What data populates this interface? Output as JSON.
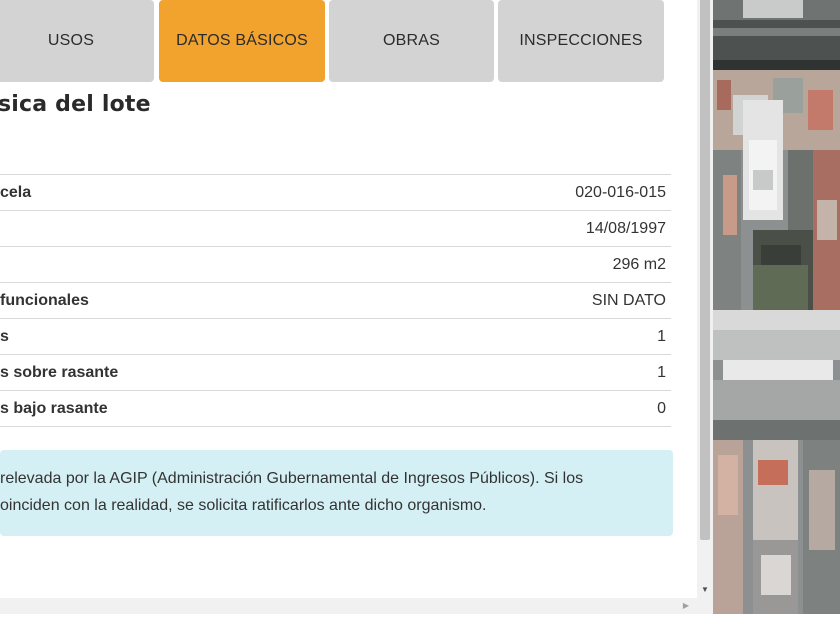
{
  "tabs": [
    {
      "label": "USOS",
      "active": false
    },
    {
      "label": "DATOS BÁSICOS",
      "active": true
    },
    {
      "label": "OBRAS",
      "active": false
    },
    {
      "label": "INSPECCIONES",
      "active": false
    }
  ],
  "section_title": "sica del lote",
  "rows": [
    {
      "label": "cela",
      "value": "020-016-015"
    },
    {
      "label": "",
      "value": "14/08/1997"
    },
    {
      "label": "",
      "value": "296 m2"
    },
    {
      "label": "funcionales",
      "value": "SIN DATO"
    },
    {
      "label": "s",
      "value": "1"
    },
    {
      "label": "s sobre rasante",
      "value": "1"
    },
    {
      "label": "s bajo rasante",
      "value": "0"
    }
  ],
  "note": {
    "line1": "relevada por la AGIP (Administración Gubernamental de Ingresos Públicos). Si los",
    "line2": "oinciden con la realidad, se solicita ratificarlos ante dicho organismo."
  },
  "colors": {
    "active_tab": "#f2a32e",
    "inactive_tab": "#d3d3d3",
    "note_bg": "#d4f0f5"
  },
  "icons": {
    "scroll_down": "▼",
    "scroll_right": "▶"
  }
}
